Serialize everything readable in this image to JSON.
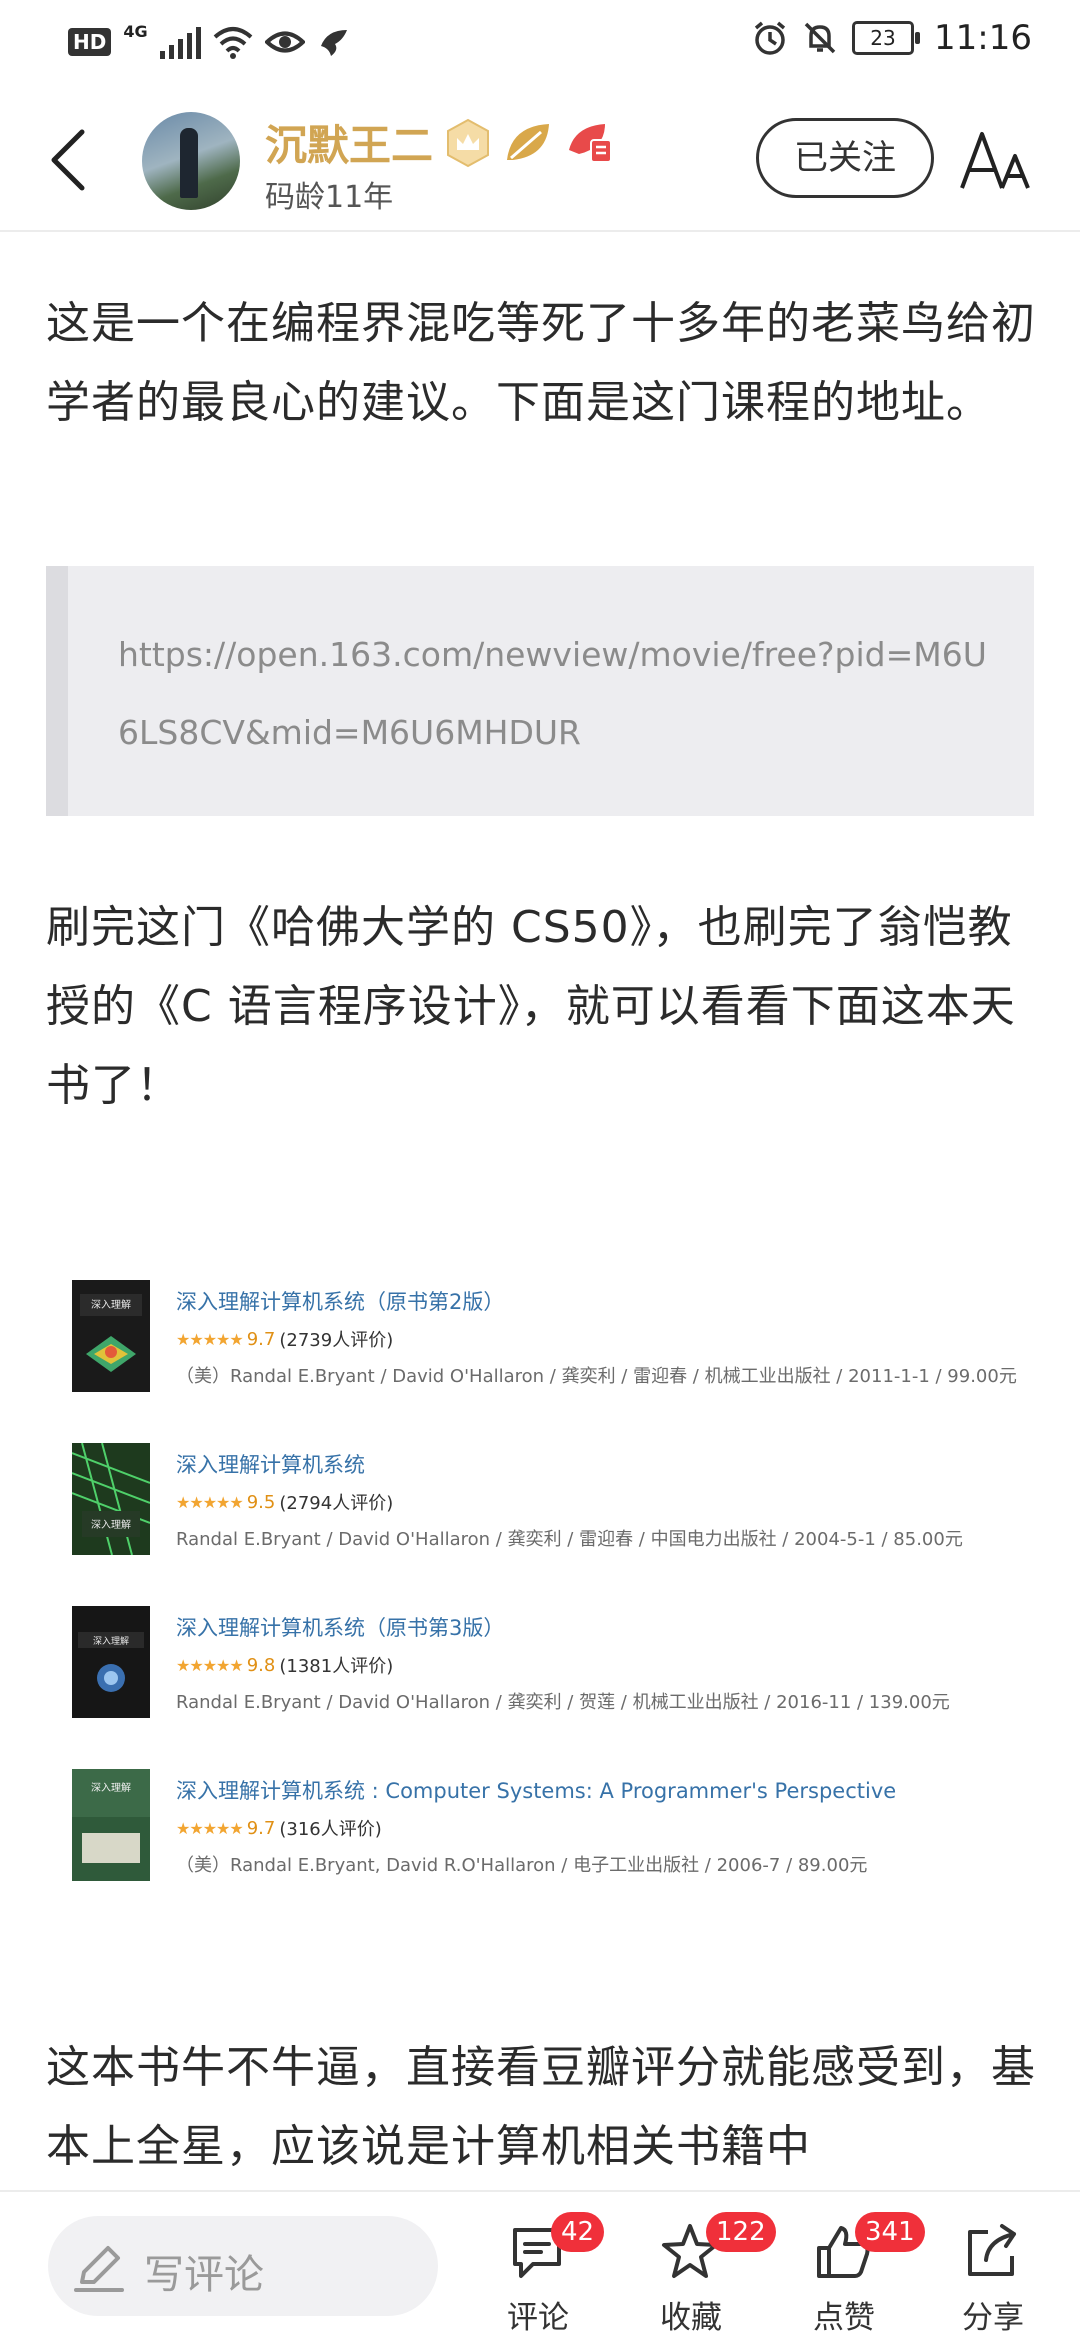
{
  "status_bar": {
    "hd": "HD",
    "network": "4G",
    "battery": "23",
    "time": "11:16"
  },
  "header": {
    "username": "沉默王二",
    "subtitle": "码龄11年",
    "follow_label": "已关注"
  },
  "article": {
    "para1": "这是一个在编程界混吃等死了十多年的老菜鸟给初学者的最良心的建议。下面是这门课程的地址。",
    "quote_url": "https://open.163.com/newview/movie/free?pid=M6U6LS8CV&mid=M6U6MHDUR",
    "para2": "刷完这门《哈佛大学的 CS50》，也刷完了翁恺教授的《C 语言程序设计》，就可以看看下面这本天书了！",
    "para3": "这本书牛不牛逼，直接看豆瓣评分就能感受到，基本上全星，应该说是计算机相关书籍中"
  },
  "books": [
    {
      "title": "深入理解计算机系统（原书第2版）",
      "stars": "★★★★★",
      "score": "9.7",
      "count": "(2739人评价)",
      "meta": "（美）Randal E.Bryant / David O'Hallaron / 龚奕利 / 雷迎春 / 机械工业出版社 / 2011-1-1 / 99.00元"
    },
    {
      "title": "深入理解计算机系统",
      "stars": "★★★★★",
      "score": "9.5",
      "count": "(2794人评价)",
      "meta": "Randal E.Bryant / David O'Hallaron / 龚奕利 / 雷迎春 / 中国电力出版社 / 2004-5-1 / 85.00元"
    },
    {
      "title": "深入理解计算机系统（原书第3版）",
      "stars": "★★★★★",
      "score": "9.8",
      "count": "(1381人评价)",
      "meta": "Randal E.Bryant / David O'Hallaron / 龚奕利 / 贺莲 / 机械工业出版社 / 2016-11 / 139.00元"
    },
    {
      "title": "深入理解计算机系统 : Computer Systems: A Programmer's Perspective",
      "stars": "★★★★★",
      "score": "9.7",
      "count": "(316人评价)",
      "meta": "（美）Randal E.Bryant, David R.O'Hallaron / 电子工业出版社 / 2006-7 / 89.00元"
    }
  ],
  "bottom_bar": {
    "comment_placeholder": "写评论",
    "comment": {
      "label": "评论",
      "count": "42"
    },
    "favorite": {
      "label": "收藏",
      "count": "122"
    },
    "like": {
      "label": "点赞",
      "count": "341"
    },
    "share": {
      "label": "分享"
    }
  },
  "colors": {
    "accent_gold": "#d1a553",
    "link_blue": "#3772a8",
    "badge_red": "#f0303a",
    "star_orange": "#f2a531"
  }
}
